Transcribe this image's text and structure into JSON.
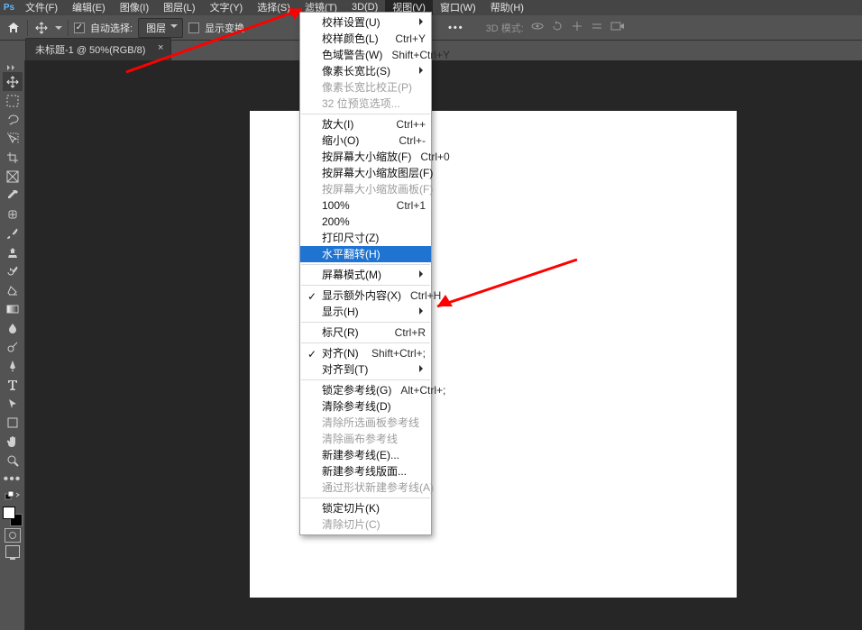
{
  "menubar": {
    "items": [
      {
        "label": "文件(F)"
      },
      {
        "label": "编辑(E)"
      },
      {
        "label": "图像(I)"
      },
      {
        "label": "图层(L)"
      },
      {
        "label": "文字(Y)"
      },
      {
        "label": "选择(S)"
      },
      {
        "label": "滤镜(T)"
      },
      {
        "label": "3D(D)"
      },
      {
        "label": "视图(V)"
      },
      {
        "label": "窗口(W)"
      },
      {
        "label": "帮助(H)"
      }
    ]
  },
  "options": {
    "auto_select_label": "自动选择:",
    "layer_dropdown": "图层",
    "show_transform_label": "显示变换",
    "mode3d_label": "3D 模式:"
  },
  "document": {
    "tab_title": "未标题-1 @ 50%(RGB/8)"
  },
  "menu": {
    "proofSetup": "校样设置(U)",
    "proofColors": {
      "label": "校样颜色(L)",
      "shortcut": "Ctrl+Y"
    },
    "gamutWarning": {
      "label": "色域警告(W)",
      "shortcut": "Shift+Ctrl+Y"
    },
    "pixelAspect": "像素长宽比(S)",
    "pixelAspectCorr": "像素长宽比校正(P)",
    "bit32Preview": "32 位预览选项...",
    "zoomIn": {
      "label": "放大(I)",
      "shortcut": "Ctrl++"
    },
    "zoomOut": {
      "label": "缩小(O)",
      "shortcut": "Ctrl+-"
    },
    "fitOnScreen": {
      "label": "按屏幕大小缩放(F)",
      "shortcut": "Ctrl+0"
    },
    "fitLayer": "按屏幕大小缩放图层(F)",
    "fitArtboard": "按屏幕大小缩放画板(F)",
    "p100": {
      "label": "100%",
      "shortcut": "Ctrl+1"
    },
    "p200": "200%",
    "printSize": "打印尺寸(Z)",
    "flipHoriz": "水平翻转(H)",
    "screenMode": "屏幕模式(M)",
    "extras": {
      "label": "显示额外内容(X)",
      "shortcut": "Ctrl+H"
    },
    "show": "显示(H)",
    "rulers": {
      "label": "标尺(R)",
      "shortcut": "Ctrl+R"
    },
    "snap": {
      "label": "对齐(N)",
      "shortcut": "Shift+Ctrl+;"
    },
    "snapTo": "对齐到(T)",
    "lockGuides": {
      "label": "锁定参考线(G)",
      "shortcut": "Alt+Ctrl+;"
    },
    "clearGuides": "清除参考线(D)",
    "clearSelArtboardGuides": "清除所选画板参考线",
    "clearCanvasGuides": "清除画布参考线",
    "newGuide": "新建参考线(E)...",
    "newGuideLayout": "新建参考线版面...",
    "guideFromShape": "通过形状新建参考线(A)",
    "lockSlice": "锁定切片(K)",
    "clearSlice": "清除切片(C)"
  }
}
